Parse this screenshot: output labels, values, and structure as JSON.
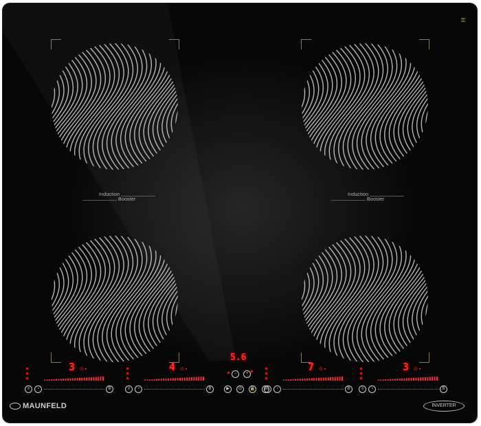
{
  "product": {
    "brand": "MAUNFELD",
    "badge": "INVERTER"
  },
  "zones": {
    "top_left": {
      "label_line1": "Induction",
      "label_line2": "Booster"
    },
    "top_right": {
      "label_line1": "Induction",
      "label_line2": "Booster"
    }
  },
  "controls": {
    "zone1_level": "3",
    "zone2_level": "4",
    "timer": "5.6",
    "zone3_level": "7",
    "zone4_level": "3"
  },
  "colors": {
    "glass": "#0a0a0a",
    "display_red": "#ff2a2a",
    "trim_gold": "#8a7a68",
    "coil_lines": "#d6d6d6"
  },
  "icons": {
    "power": "power-icon",
    "lock": "lock-icon",
    "pause": "pause-icon",
    "timer_minus": "timer-minus-icon",
    "timer_plus": "timer-plus-icon",
    "key": "key-icon"
  }
}
